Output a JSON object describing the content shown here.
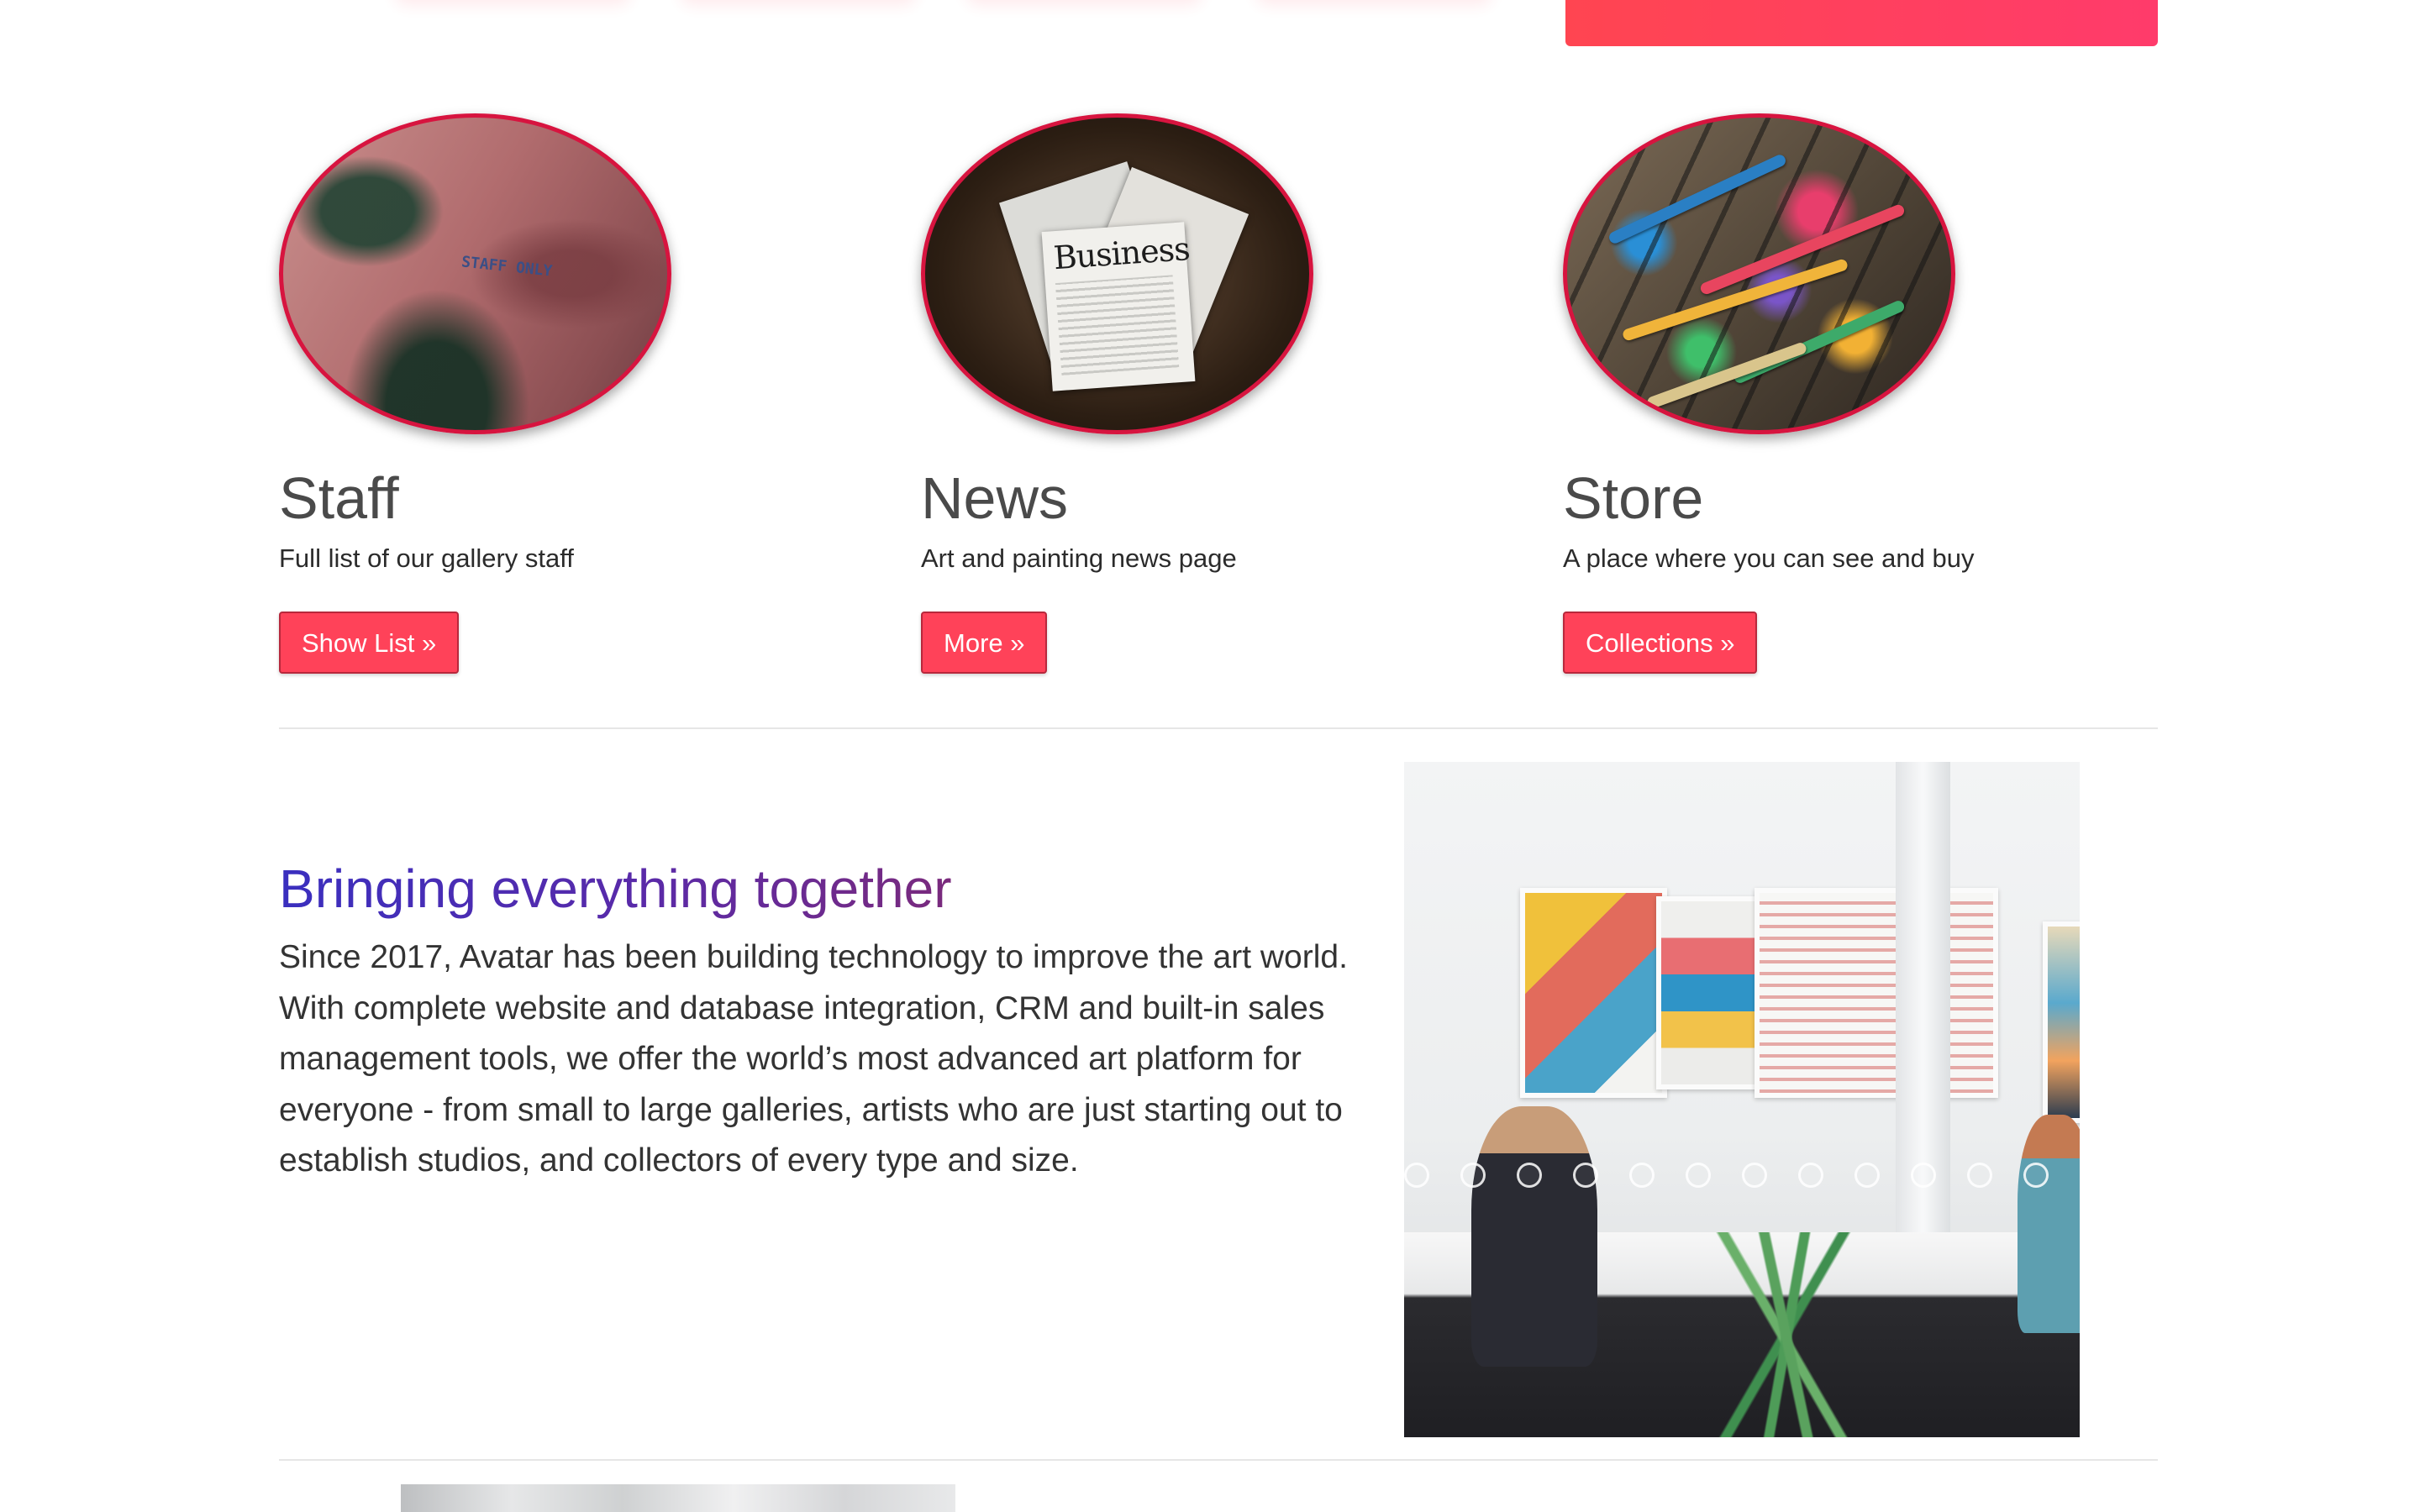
{
  "cards": [
    {
      "title": "Staff",
      "description": "Full list of our gallery staff",
      "button": "Show List »",
      "sign_text": "STAFF ONLY"
    },
    {
      "title": "News",
      "description": "Art and painting news page",
      "button": "More »",
      "paper_title": "Business"
    },
    {
      "title": "Store",
      "description": "A place where you can see and buy",
      "button": "Collections »"
    }
  ],
  "feature": {
    "title": "Bringing everything together",
    "text": "Since 2017, Avatar has been building technology to improve the art world. With complete website and database integration, CRM and built-in sales management tools, we offer the world’s most advanced art platform for everyone - from small to large galleries, artists who are just starting out to establish studios, and collectors of every type and size.",
    "slide_count": 12
  },
  "colors": {
    "accent": "#ff4259",
    "ring": "#d7143f",
    "title_gradient_start": "#3a2fbf",
    "title_gradient_end": "#7a2a7c"
  }
}
